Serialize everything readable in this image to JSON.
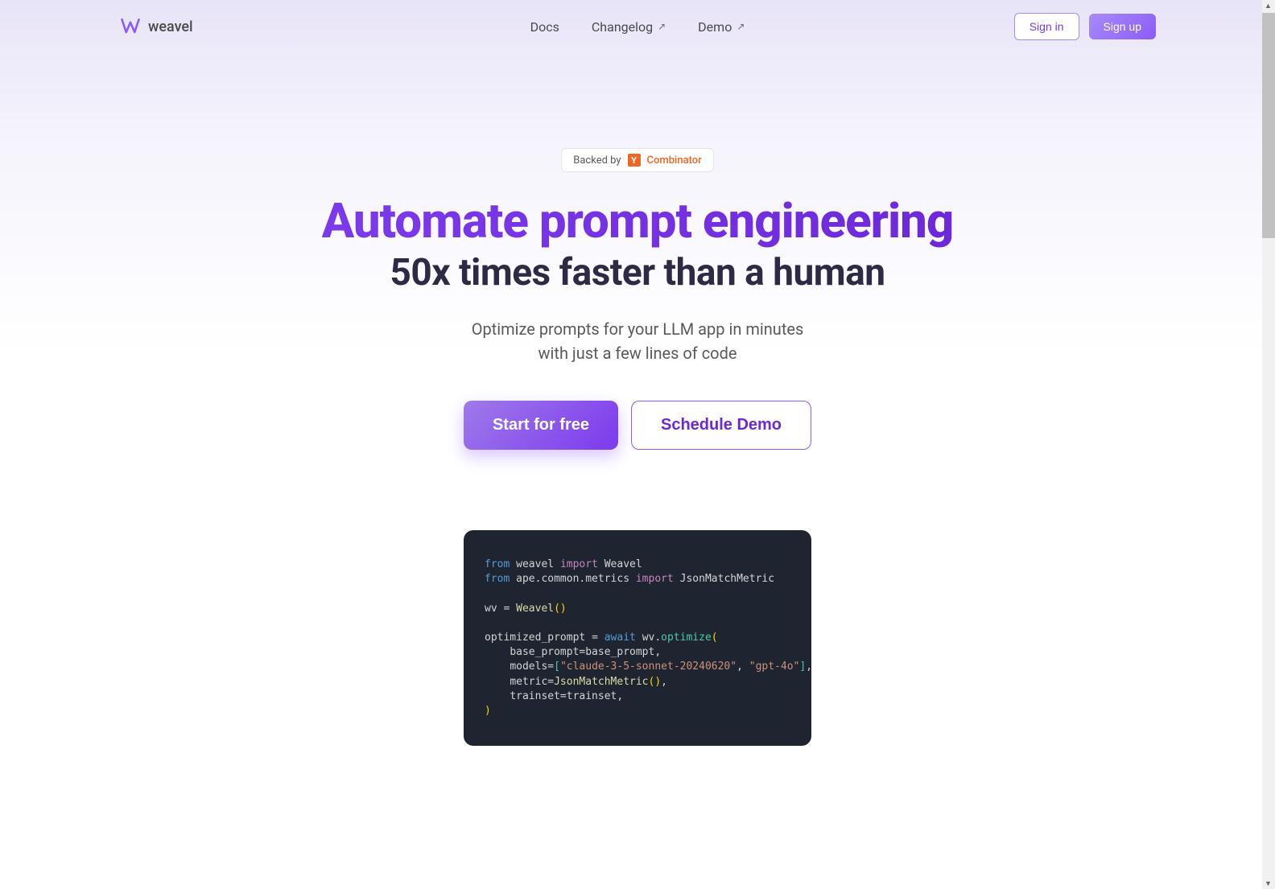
{
  "brand": {
    "name": "weavel"
  },
  "nav": {
    "items": [
      {
        "label": "Docs",
        "external": false
      },
      {
        "label": "Changelog",
        "external": true
      },
      {
        "label": "Demo",
        "external": true
      }
    ]
  },
  "auth": {
    "signin": "Sign in",
    "signup": "Sign up"
  },
  "badge": {
    "prefix": "Backed by",
    "yc_letter": "Y",
    "yc_name": "Combinator"
  },
  "hero": {
    "headline_main": "Automate prompt engineering",
    "headline_sub": "50x times faster than a human",
    "tagline_line1": "Optimize prompts for your LLM app in minutes",
    "tagline_line2": "with just a few lines of code",
    "cta_primary": "Start for free",
    "cta_secondary": "Schedule Demo"
  },
  "code": {
    "line1": {
      "kw": "from",
      "mod": "weavel",
      "imp": "import",
      "cls": "Weavel"
    },
    "line2": {
      "kw": "from",
      "mod": "ape.common.metrics",
      "imp": "import",
      "cls": "JsonMatchMetric"
    },
    "line3": {
      "var": "wv",
      "eq": "=",
      "cls": "Weavel",
      "paren": "()"
    },
    "line4": {
      "var": "optimized_prompt",
      "eq": "=",
      "await": "await",
      "obj": "wv.",
      "fn": "optimize",
      "open": "("
    },
    "line5": {
      "indent": "    ",
      "param": "base_prompt=base_prompt",
      "comma": ","
    },
    "line6": {
      "indent": "    ",
      "param": "models=",
      "open": "[",
      "s1": "\"claude-3-5-sonnet-20240620\"",
      "c1": ", ",
      "s2": "\"gpt-4o\"",
      "close": "]",
      "comma": ","
    },
    "line7": {
      "indent": "    ",
      "param": "metric=",
      "cls": "JsonMatchMetric",
      "paren": "()",
      "comma": ","
    },
    "line8": {
      "indent": "    ",
      "param": "trainset=trainset",
      "comma": ","
    },
    "line9": {
      "close": ")"
    }
  }
}
